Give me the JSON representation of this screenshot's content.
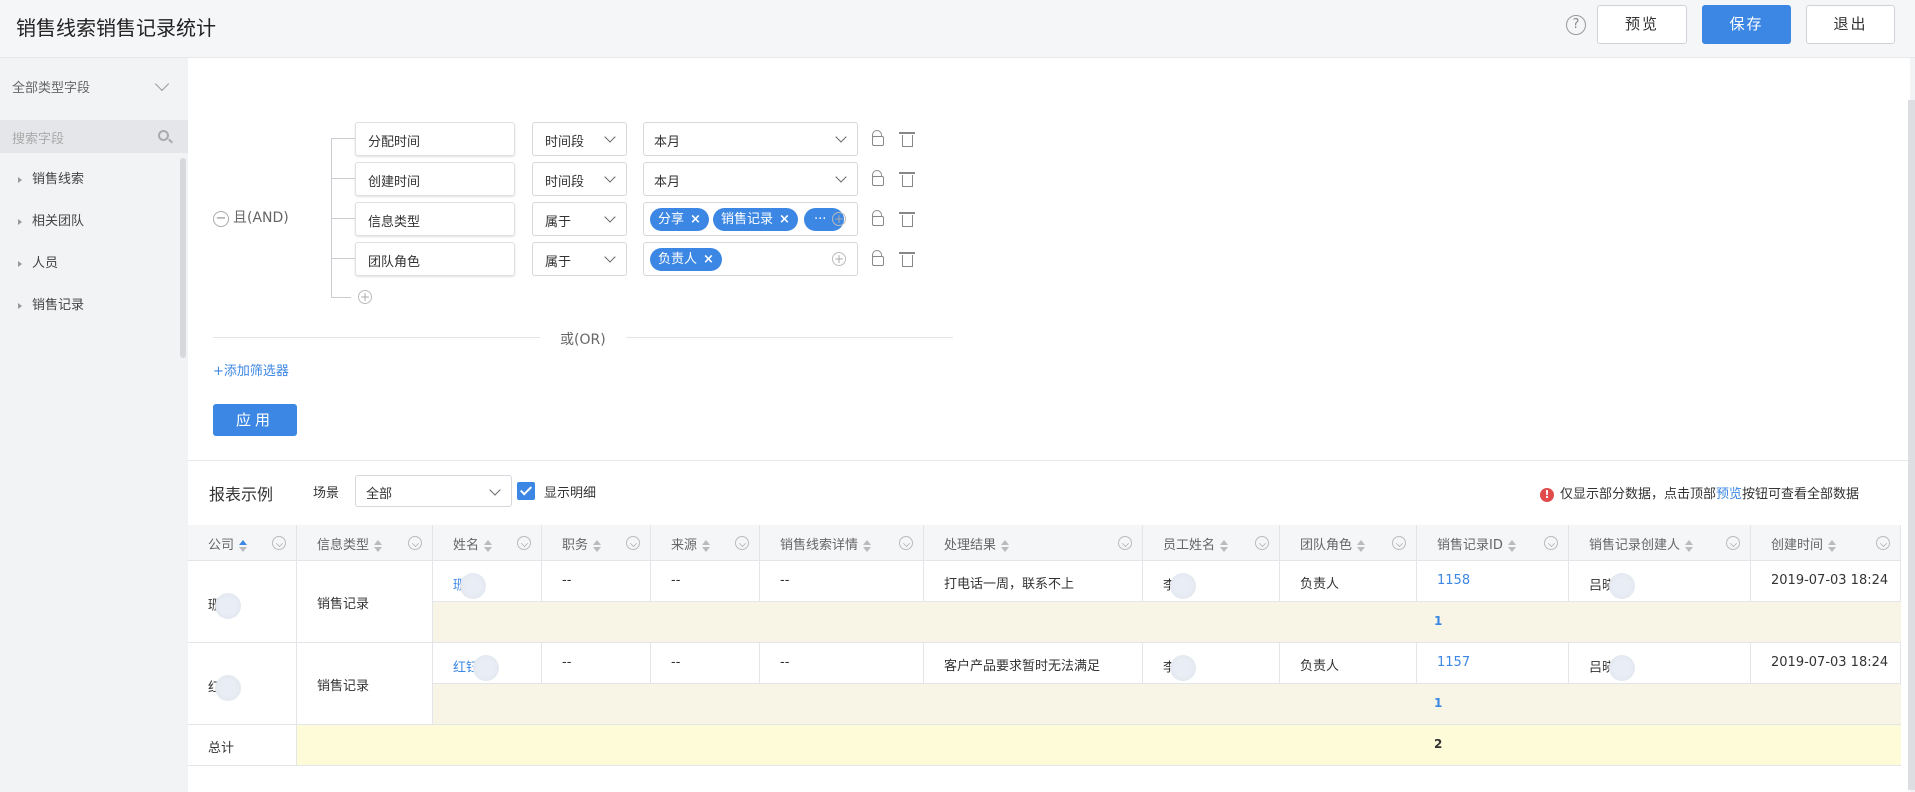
{
  "header": {
    "title": "销售线索销售记录统计",
    "help_icon": "?",
    "preview_label": "预览",
    "save_label": "保存",
    "exit_label": "退出"
  },
  "sidebar": {
    "type_select": "全部类型字段",
    "search_placeholder": "搜索字段",
    "items": [
      {
        "label": "销售线索"
      },
      {
        "label": "相关团队"
      },
      {
        "label": "人员"
      },
      {
        "label": "销售记录"
      }
    ]
  },
  "filters": {
    "group_label": "且(AND)",
    "conditions": [
      {
        "field": "分配时间",
        "op": "时间段",
        "value": "本月",
        "tags": []
      },
      {
        "field": "创建时间",
        "op": "时间段",
        "value": "本月",
        "tags": []
      },
      {
        "field": "信息类型",
        "op": "属于",
        "value": "",
        "tags": [
          "分享",
          "销售记录",
          "···"
        ]
      },
      {
        "field": "团队角色",
        "op": "属于",
        "value": "",
        "tags": [
          "负责人"
        ]
      }
    ],
    "or_label": "或(OR)",
    "add_filter": "+添加筛选器",
    "apply": "应用",
    "tag_close": "×"
  },
  "report": {
    "title": "报表示例",
    "scene_label": "场景",
    "scene_value": "全部",
    "detail_label": "显示明细",
    "notice_icon": "!",
    "notice_pre": "仅显示部分数据，点击顶部",
    "notice_link": "预览",
    "notice_post": "按钮可查看全部数据",
    "columns": [
      "公司",
      "信息类型",
      "姓名",
      "职务",
      "来源",
      "销售线索详情",
      "处理结果",
      "员工姓名",
      "团队角色",
      "销售记录ID",
      "销售记录创建人",
      "创建时间"
    ],
    "rows": [
      {
        "company": "珊",
        "info_type": "销售记录",
        "name": "珊",
        "title": "--",
        "source": "--",
        "detail": "--",
        "result": "打电话一周，联系不上",
        "employee": "李",
        "role": "负责人",
        "record_id": "1158",
        "creator": "吕晓",
        "created": "2019-07-03 18:24",
        "subtotal": "1"
      },
      {
        "company": "红",
        "info_type": "销售记录",
        "name": "红钰",
        "title": "--",
        "source": "--",
        "detail": "--",
        "result": "客户产品要求暂时无法满足",
        "employee": "李",
        "role": "负责人",
        "record_id": "1157",
        "creator": "吕晓",
        "created": "2019-07-03 18:24",
        "subtotal": "1"
      }
    ],
    "total_label": "总计",
    "total_value": "2"
  },
  "colors": {
    "accent": "#3c87e3",
    "subtotal_bg": "#f8f5e6",
    "total_bg": "#fdfbd8"
  }
}
